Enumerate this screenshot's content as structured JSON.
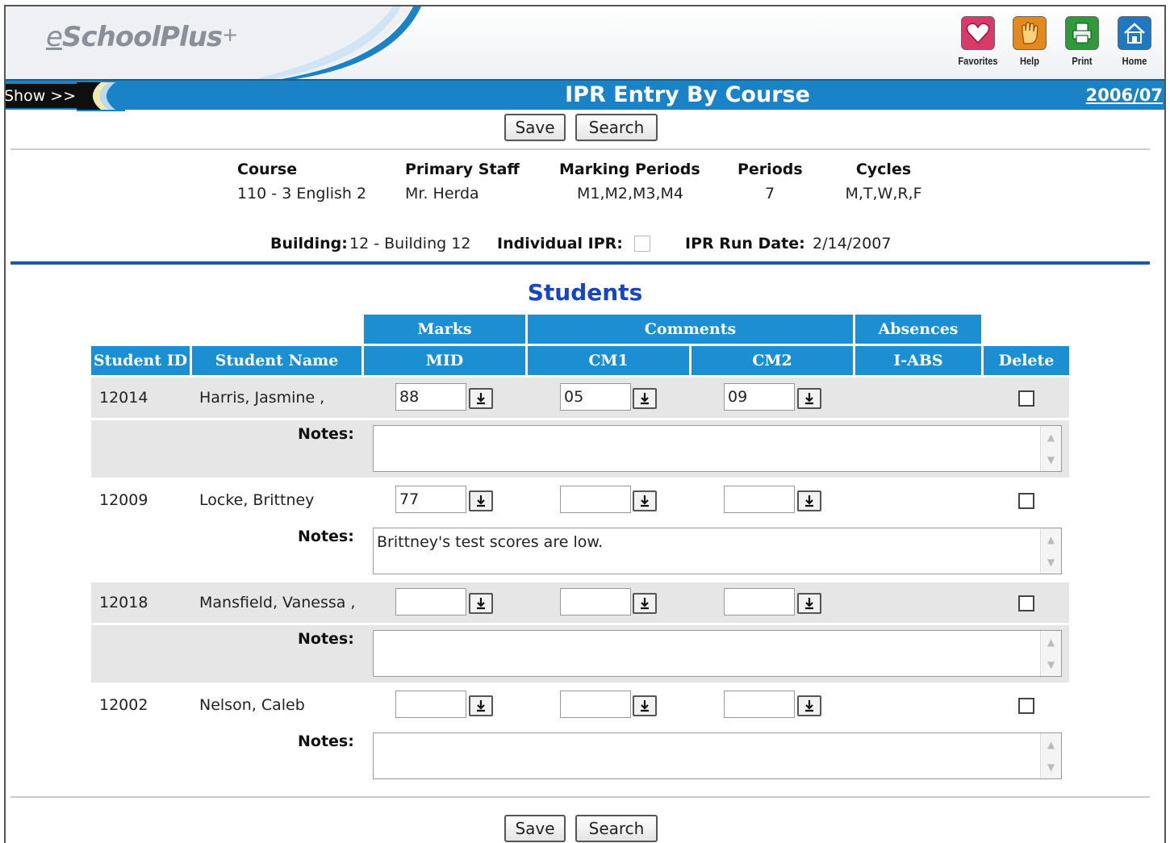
{
  "app": {
    "logo_e": "e",
    "logo_main": "SchoolPlus",
    "logo_plus": "+"
  },
  "toolbar": [
    {
      "label": "Favorites",
      "icon": "heart-icon",
      "color": "#d83a6a"
    },
    {
      "label": "Help",
      "icon": "hand-icon",
      "color": "#e48a1c"
    },
    {
      "label": "Print",
      "icon": "printer-icon",
      "color": "#2e9a3a"
    },
    {
      "label": "Home",
      "icon": "house-icon",
      "color": "#1e78c2"
    }
  ],
  "titlebar": {
    "show_label": "Show >>",
    "title": "IPR Entry By Course",
    "year": "2006/07"
  },
  "buttons": {
    "save": "Save",
    "search": "Search"
  },
  "course_info": {
    "course_label": "Course",
    "course_value": "110 - 3 English 2",
    "staff_label": "Primary Staff",
    "staff_value": "Mr. Herda",
    "mp_label": "Marking Periods",
    "mp_value": "M1,M2,M3,M4",
    "periods_label": "Periods",
    "periods_value": "7",
    "cycles_label": "Cycles",
    "cycles_value": "M,T,W,R,F",
    "building_label": "Building:",
    "building_value": "12 - Building 12",
    "individual_label": "Individual IPR:",
    "individual_checked": false,
    "run_date_label": "IPR Run Date:",
    "run_date_value": "2/14/2007"
  },
  "students_section": {
    "title": "Students",
    "group_headers": {
      "marks": "Marks",
      "comments": "Comments",
      "absences": "Absences"
    },
    "columns": {
      "student_id": "Student ID",
      "student_name": "Student Name",
      "mid": "MID",
      "cm1": "CM1",
      "cm2": "CM2",
      "iabs": "I-ABS",
      "delete": "Delete"
    },
    "notes_label": "Notes:",
    "rows": [
      {
        "id": "12014",
        "name": "Harris, Jasmine ,",
        "mid": "88",
        "cm1": "05",
        "cm2": "09",
        "notes": "",
        "delete": false
      },
      {
        "id": "12009",
        "name": "Locke, Brittney",
        "mid": "77",
        "cm1": "",
        "cm2": "",
        "notes": "Brittney's test scores are low.",
        "delete": false
      },
      {
        "id": "12018",
        "name": "Mansfield, Vanessa ,",
        "mid": "",
        "cm1": "",
        "cm2": "",
        "notes": "",
        "delete": false
      },
      {
        "id": "12002",
        "name": "Nelson, Caleb",
        "mid": "",
        "cm1": "",
        "cm2": "",
        "notes": "",
        "delete": false
      }
    ]
  },
  "colors": {
    "header_blue": "#1b8fd2",
    "title_blue": "#1646c6",
    "row_gray": "#e6e6e6"
  }
}
